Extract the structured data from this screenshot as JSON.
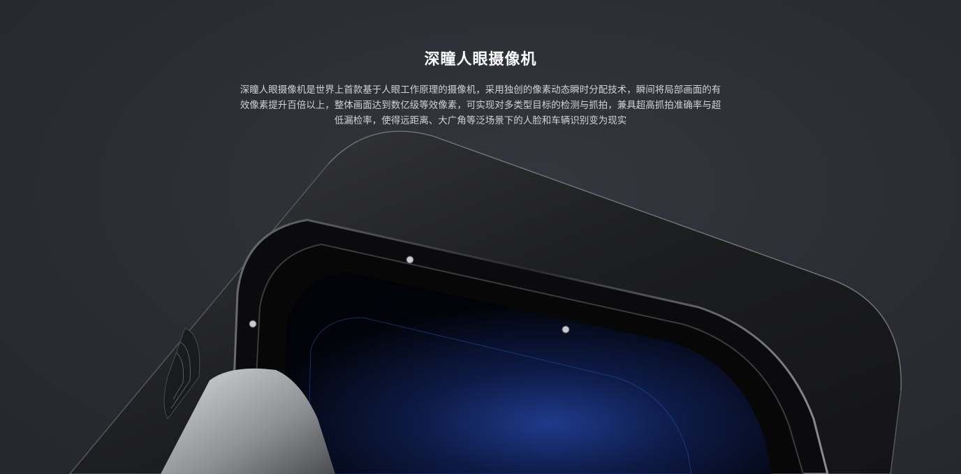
{
  "section": {
    "title": "深瞳人眼摄像机",
    "description": "深瞳人眼摄像机是世界上首款基于人眼工作原理的摄像机，采用独创的像素动态瞬时分配技术，瞬间将局部画面的有效像素提升百倍以上，整体画面达到数亿级等效像素，可实现对多类型目标的检测与抓拍，兼具超高抓拍准确率与超低漏检率，使得远距离、大广角等泛场景下的人脸和车辆识别变为现实"
  },
  "image": {
    "subject": "deep-pupil-camera-product-photo"
  },
  "colors": {
    "background": "#2b2e33",
    "title": "#ffffff",
    "text": "#cfd2d6",
    "lens_blue": "#1e3a8a"
  }
}
